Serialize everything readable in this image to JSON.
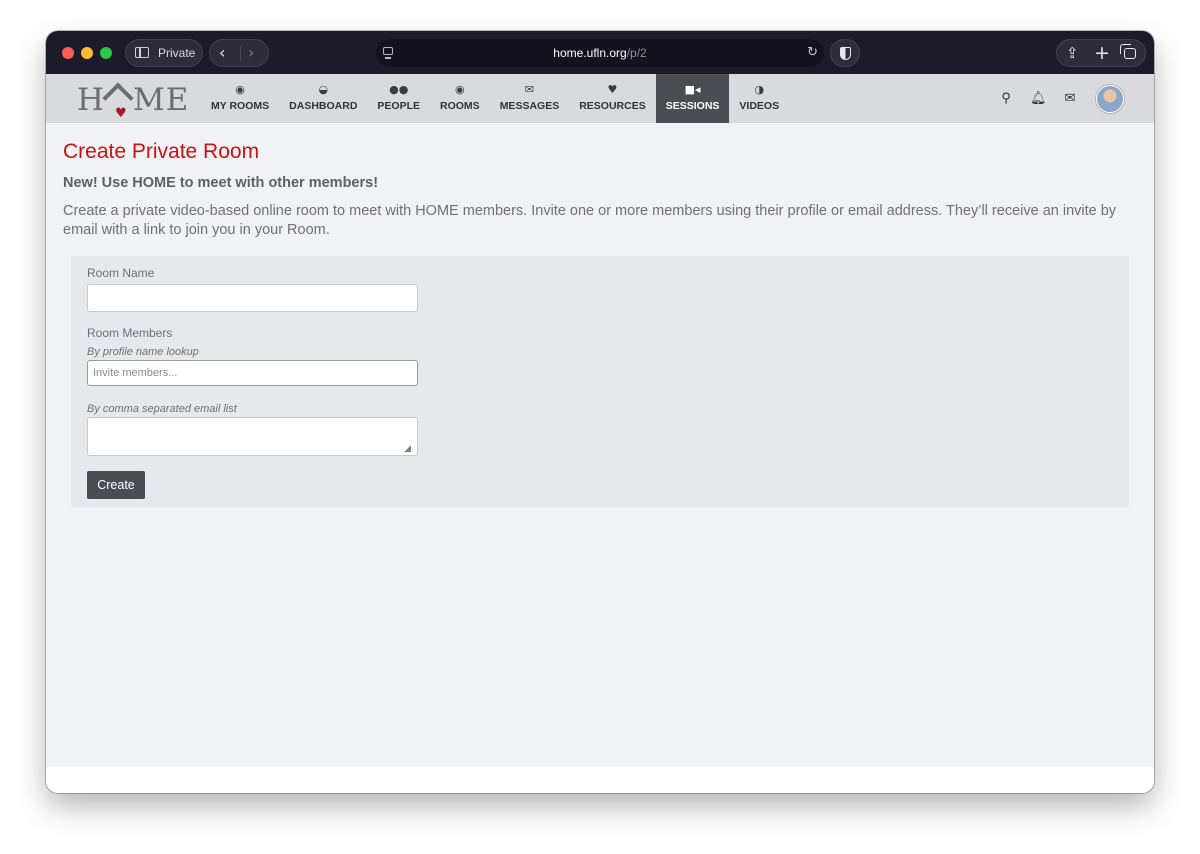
{
  "browser": {
    "private_label": "Private",
    "url_host": "home.ufln.org",
    "url_path": "/p/2"
  },
  "site": {
    "logo_text": "HOME",
    "nav": [
      {
        "icon": "target-icon",
        "label": "MY ROOMS",
        "active": false
      },
      {
        "icon": "dashboard-icon",
        "label": "DASHBOARD",
        "active": false
      },
      {
        "icon": "people-icon",
        "label": "PEOPLE",
        "active": false
      },
      {
        "icon": "target-icon",
        "label": "ROOMS",
        "active": false
      },
      {
        "icon": "envelope-icon",
        "label": "MESSAGES",
        "active": false
      },
      {
        "icon": "heart-icon",
        "label": "RESOURCES",
        "active": false
      },
      {
        "icon": "video-camera-icon",
        "label": "SESSIONS",
        "active": true
      },
      {
        "icon": "contrast-icon",
        "label": "VIDEOS",
        "active": false
      }
    ],
    "tools": [
      "search-icon",
      "bell-icon",
      "envelope-icon"
    ]
  },
  "page": {
    "title": "Create Private Room",
    "subtitle": "New! Use HOME to meet with other members!",
    "intro": "Create a private video-based online room to meet with HOME members. Invite one or more members using their profile or email address. They’ll receive an invite by email with a link to join you in your Room."
  },
  "form": {
    "room_name_label": "Room Name",
    "room_name_value": "",
    "members_label": "Room Members",
    "profile_hint": "By profile name lookup",
    "members_placeholder": "Invite members...",
    "email_hint": "By comma separated email list",
    "email_value": "",
    "create_label": "Create"
  },
  "colors": {
    "title_red": "#cc1111",
    "nav_active": "#4b4d52",
    "button": "#4b4d55"
  }
}
